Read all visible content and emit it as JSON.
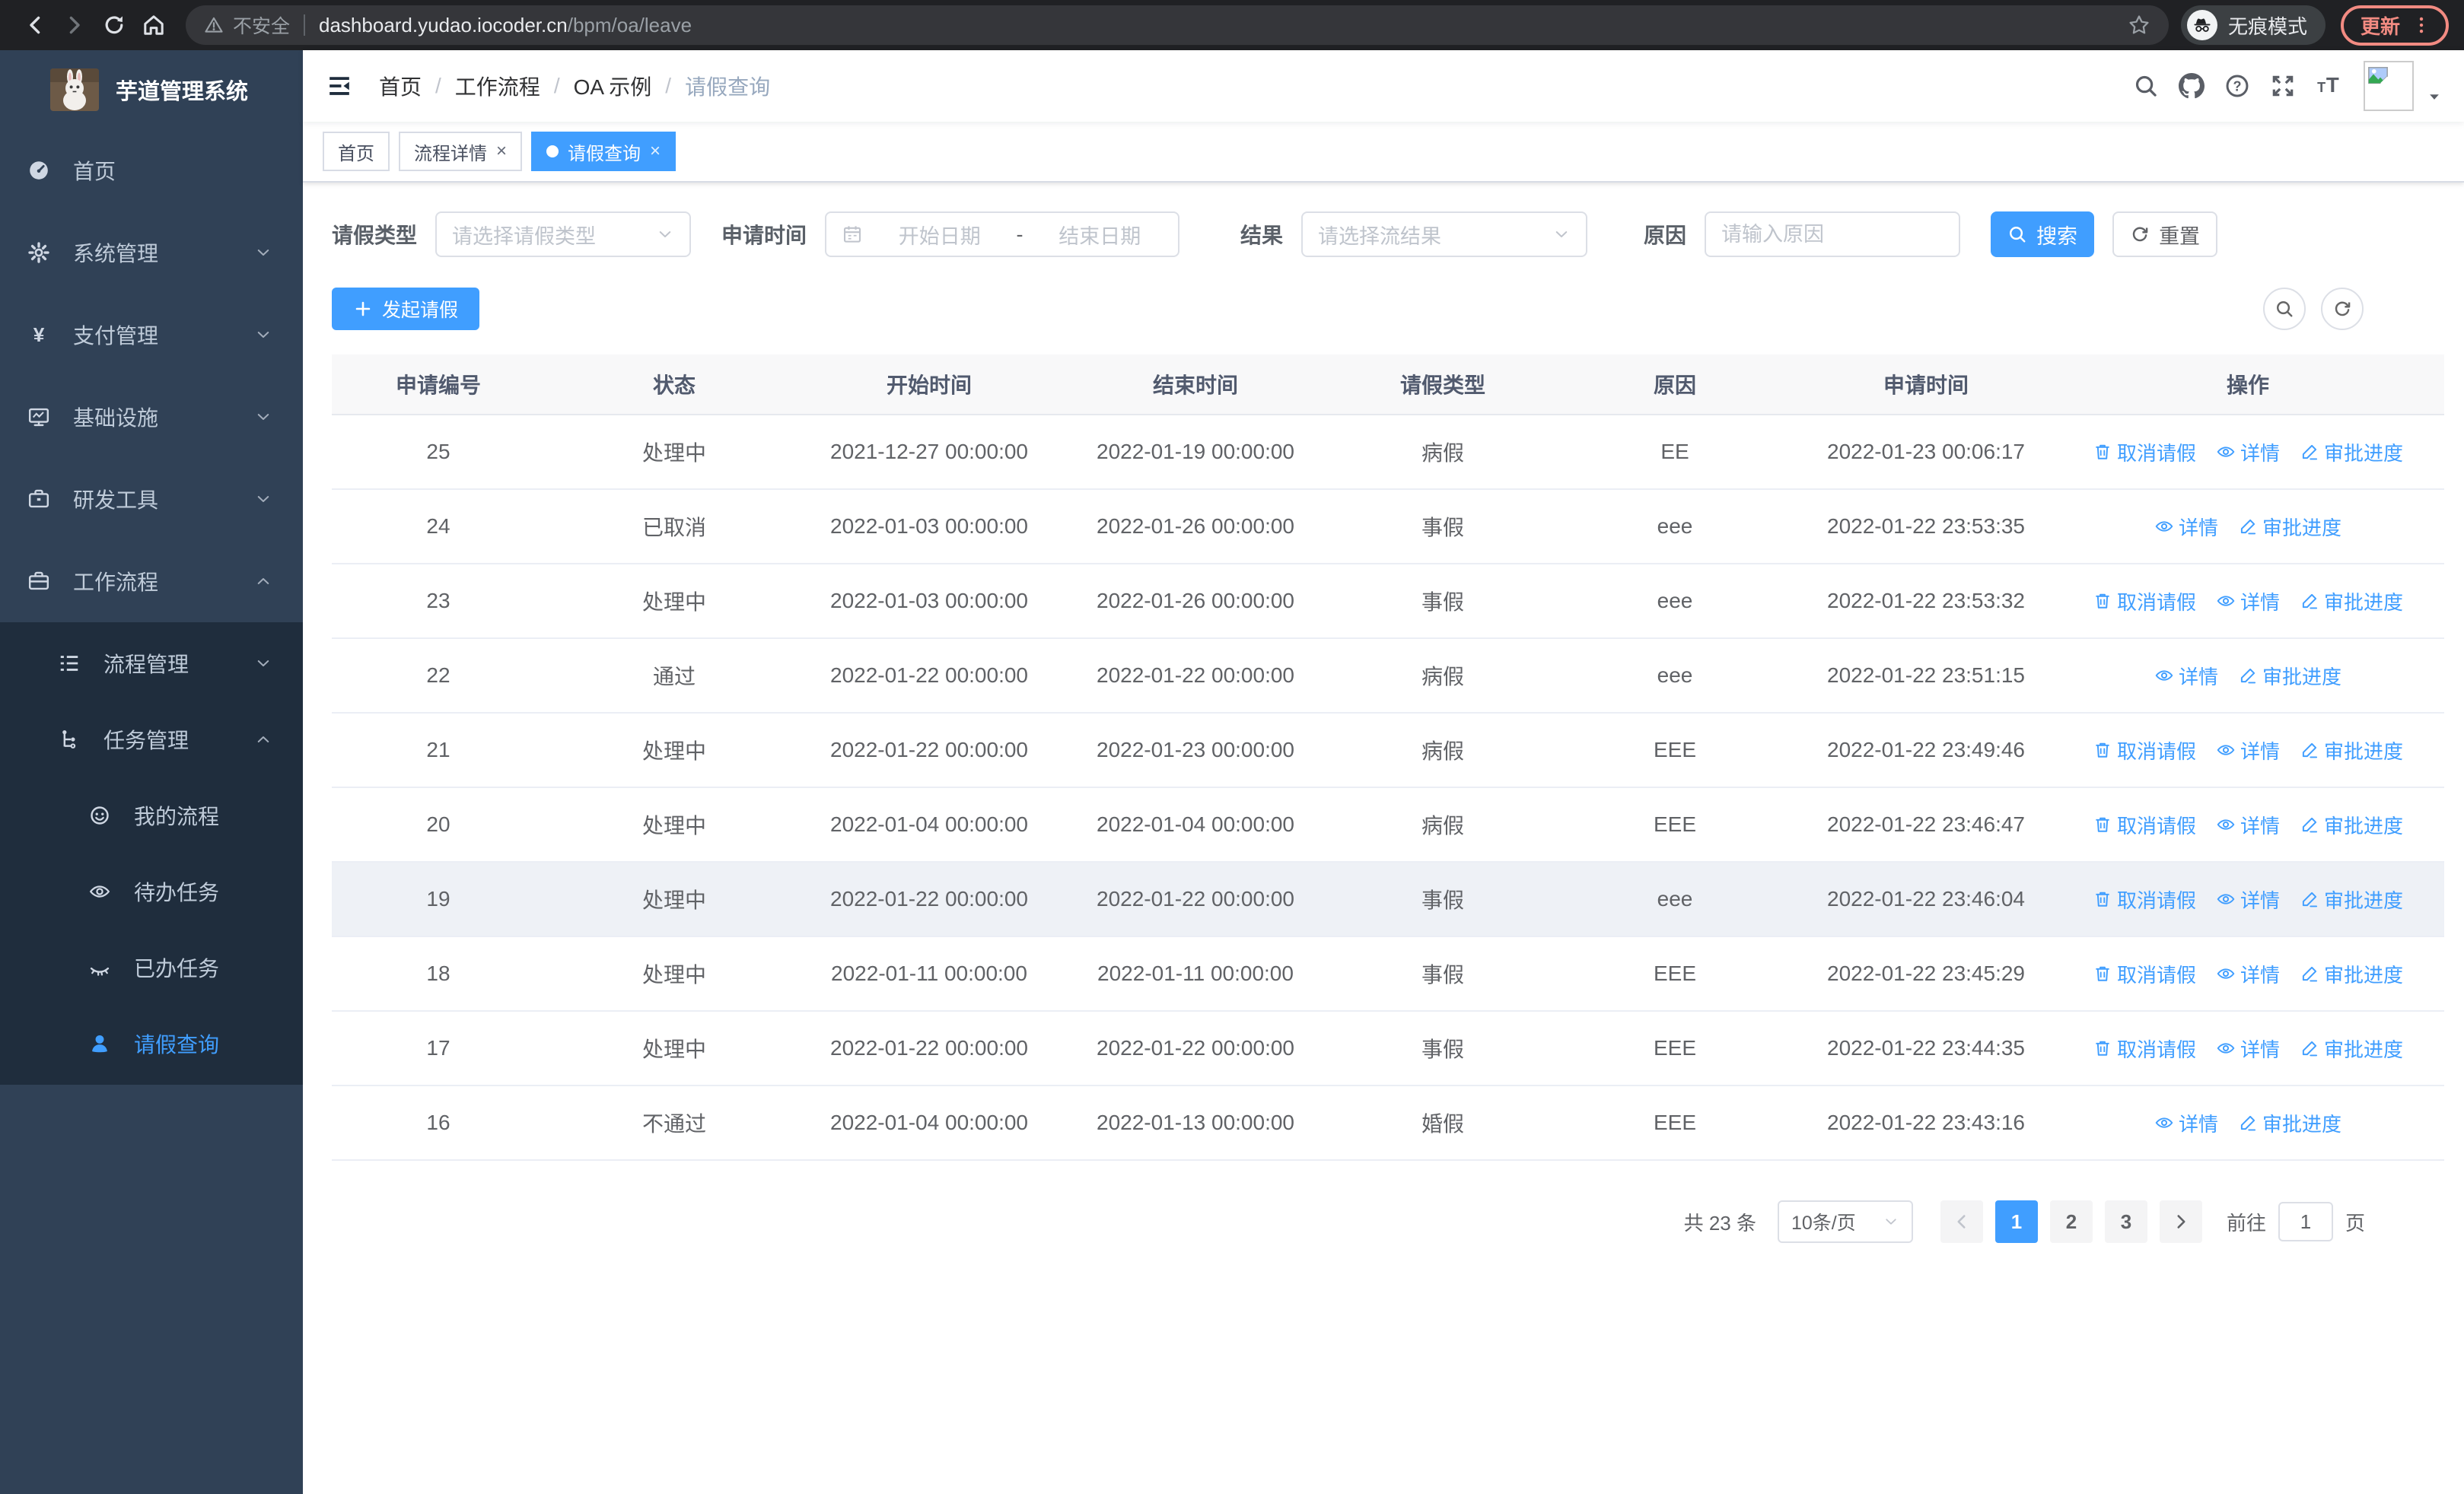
{
  "browser": {
    "security_warning": "不安全",
    "url_host": "dashboard.yudao.iocoder.cn",
    "url_path": "/bpm/oa/leave",
    "incognito_label": "无痕模式",
    "update_label": "更新"
  },
  "sidebar": {
    "title": "芋道管理系统",
    "items": [
      {
        "name": "home",
        "label": "首页",
        "icon": "dashboard-icon",
        "level": 1
      },
      {
        "name": "system-mgmt",
        "label": "系统管理",
        "icon": "gear-icon",
        "level": 1,
        "arrow": "down"
      },
      {
        "name": "payment-mgmt",
        "label": "支付管理",
        "icon": "yen-icon",
        "level": 1,
        "arrow": "down"
      },
      {
        "name": "infrastructure",
        "label": "基础设施",
        "icon": "monitor-icon",
        "level": 1,
        "arrow": "down"
      },
      {
        "name": "dev-tools",
        "label": "研发工具",
        "icon": "briefcase-icon",
        "level": 1,
        "arrow": "down"
      },
      {
        "name": "workflow",
        "label": "工作流程",
        "icon": "suitcase-icon",
        "level": 1,
        "arrow": "up"
      },
      {
        "name": "process-mgmt",
        "label": "流程管理",
        "icon": "list-icon",
        "level": 2,
        "arrow": "down",
        "dark": true
      },
      {
        "name": "task-mgmt",
        "label": "任务管理",
        "icon": "tree-icon",
        "level": 2,
        "arrow": "up",
        "dark": true
      },
      {
        "name": "my-process",
        "label": "我的流程",
        "icon": "face-icon",
        "level": 3,
        "dark": true
      },
      {
        "name": "todo-tasks",
        "label": "待办任务",
        "icon": "eye-open-icon",
        "level": 3,
        "dark": true
      },
      {
        "name": "done-tasks",
        "label": "已办任务",
        "icon": "eye-closed-icon",
        "level": 3,
        "dark": true
      },
      {
        "name": "leave-query",
        "label": "请假查询",
        "icon": "user-icon",
        "level": 3,
        "dark": true,
        "active": true
      }
    ]
  },
  "breadcrumb": {
    "items": [
      "首页",
      "工作流程",
      "OA 示例",
      "请假查询"
    ]
  },
  "tabs": {
    "items": [
      {
        "name": "home",
        "label": "首页",
        "closable": false,
        "active": false
      },
      {
        "name": "process-detail",
        "label": "流程详情",
        "closable": true,
        "active": false
      },
      {
        "name": "leave-query",
        "label": "请假查询",
        "closable": true,
        "active": true
      }
    ]
  },
  "filters": {
    "leave_type": {
      "label": "请假类型",
      "placeholder": "请选择请假类型"
    },
    "apply_time": {
      "label": "申请时间",
      "start_placeholder": "开始日期",
      "separator": "-",
      "end_placeholder": "结束日期"
    },
    "result": {
      "label": "结果",
      "placeholder": "请选择流结果"
    },
    "reason": {
      "label": "原因",
      "placeholder": "请输入原因"
    },
    "search_label": "搜索",
    "reset_label": "重置"
  },
  "toolbar": {
    "create_label": "发起请假"
  },
  "table": {
    "columns": [
      "申请编号",
      "状态",
      "开始时间",
      "结束时间",
      "请假类型",
      "原因",
      "申请时间",
      "操作"
    ],
    "action_labels": {
      "cancel": "取消请假",
      "detail": "详情",
      "progress": "审批进度"
    },
    "rows": [
      {
        "id": "25",
        "status": "处理中",
        "start": "2021-12-27 00:00:00",
        "end": "2022-01-19 00:00:00",
        "type": "病假",
        "reason": "EE",
        "apply_time": "2022-01-23 00:06:17",
        "actions": [
          "cancel",
          "detail",
          "progress"
        ],
        "highlighted": false
      },
      {
        "id": "24",
        "status": "已取消",
        "start": "2022-01-03 00:00:00",
        "end": "2022-01-26 00:00:00",
        "type": "事假",
        "reason": "eee",
        "apply_time": "2022-01-22 23:53:35",
        "actions": [
          "detail",
          "progress"
        ],
        "highlighted": false
      },
      {
        "id": "23",
        "status": "处理中",
        "start": "2022-01-03 00:00:00",
        "end": "2022-01-26 00:00:00",
        "type": "事假",
        "reason": "eee",
        "apply_time": "2022-01-22 23:53:32",
        "actions": [
          "cancel",
          "detail",
          "progress"
        ],
        "highlighted": false
      },
      {
        "id": "22",
        "status": "通过",
        "start": "2022-01-22 00:00:00",
        "end": "2022-01-22 00:00:00",
        "type": "病假",
        "reason": "eee",
        "apply_time": "2022-01-22 23:51:15",
        "actions": [
          "detail",
          "progress"
        ],
        "highlighted": false
      },
      {
        "id": "21",
        "status": "处理中",
        "start": "2022-01-22 00:00:00",
        "end": "2022-01-23 00:00:00",
        "type": "病假",
        "reason": "EEE",
        "apply_time": "2022-01-22 23:49:46",
        "actions": [
          "cancel",
          "detail",
          "progress"
        ],
        "highlighted": false
      },
      {
        "id": "20",
        "status": "处理中",
        "start": "2022-01-04 00:00:00",
        "end": "2022-01-04 00:00:00",
        "type": "病假",
        "reason": "EEE",
        "apply_time": "2022-01-22 23:46:47",
        "actions": [
          "cancel",
          "detail",
          "progress"
        ],
        "highlighted": false
      },
      {
        "id": "19",
        "status": "处理中",
        "start": "2022-01-22 00:00:00",
        "end": "2022-01-22 00:00:00",
        "type": "事假",
        "reason": "eee",
        "apply_time": "2022-01-22 23:46:04",
        "actions": [
          "cancel",
          "detail",
          "progress"
        ],
        "highlighted": true
      },
      {
        "id": "18",
        "status": "处理中",
        "start": "2022-01-11 00:00:00",
        "end": "2022-01-11 00:00:00",
        "type": "事假",
        "reason": "EEE",
        "apply_time": "2022-01-22 23:45:29",
        "actions": [
          "cancel",
          "detail",
          "progress"
        ],
        "highlighted": false
      },
      {
        "id": "17",
        "status": "处理中",
        "start": "2022-01-22 00:00:00",
        "end": "2022-01-22 00:00:00",
        "type": "事假",
        "reason": "EEE",
        "apply_time": "2022-01-22 23:44:35",
        "actions": [
          "cancel",
          "detail",
          "progress"
        ],
        "highlighted": false
      },
      {
        "id": "16",
        "status": "不通过",
        "start": "2022-01-04 00:00:00",
        "end": "2022-01-13 00:00:00",
        "type": "婚假",
        "reason": "EEE",
        "apply_time": "2022-01-22 23:43:16",
        "actions": [
          "detail",
          "progress"
        ],
        "highlighted": false
      }
    ]
  },
  "pagination": {
    "total_text": "共 23 条",
    "page_size": "10条/页",
    "pages": [
      "1",
      "2",
      "3"
    ],
    "active_page": "1",
    "goto_label": "前往",
    "goto_value": "1",
    "page_suffix": "页"
  },
  "colors": {
    "primary": "#409eff",
    "sidebar_bg": "#304156",
    "submenu_bg": "#1f2d3d",
    "update_accent": "#f28b82",
    "row_highlight": "#eef1f6"
  }
}
